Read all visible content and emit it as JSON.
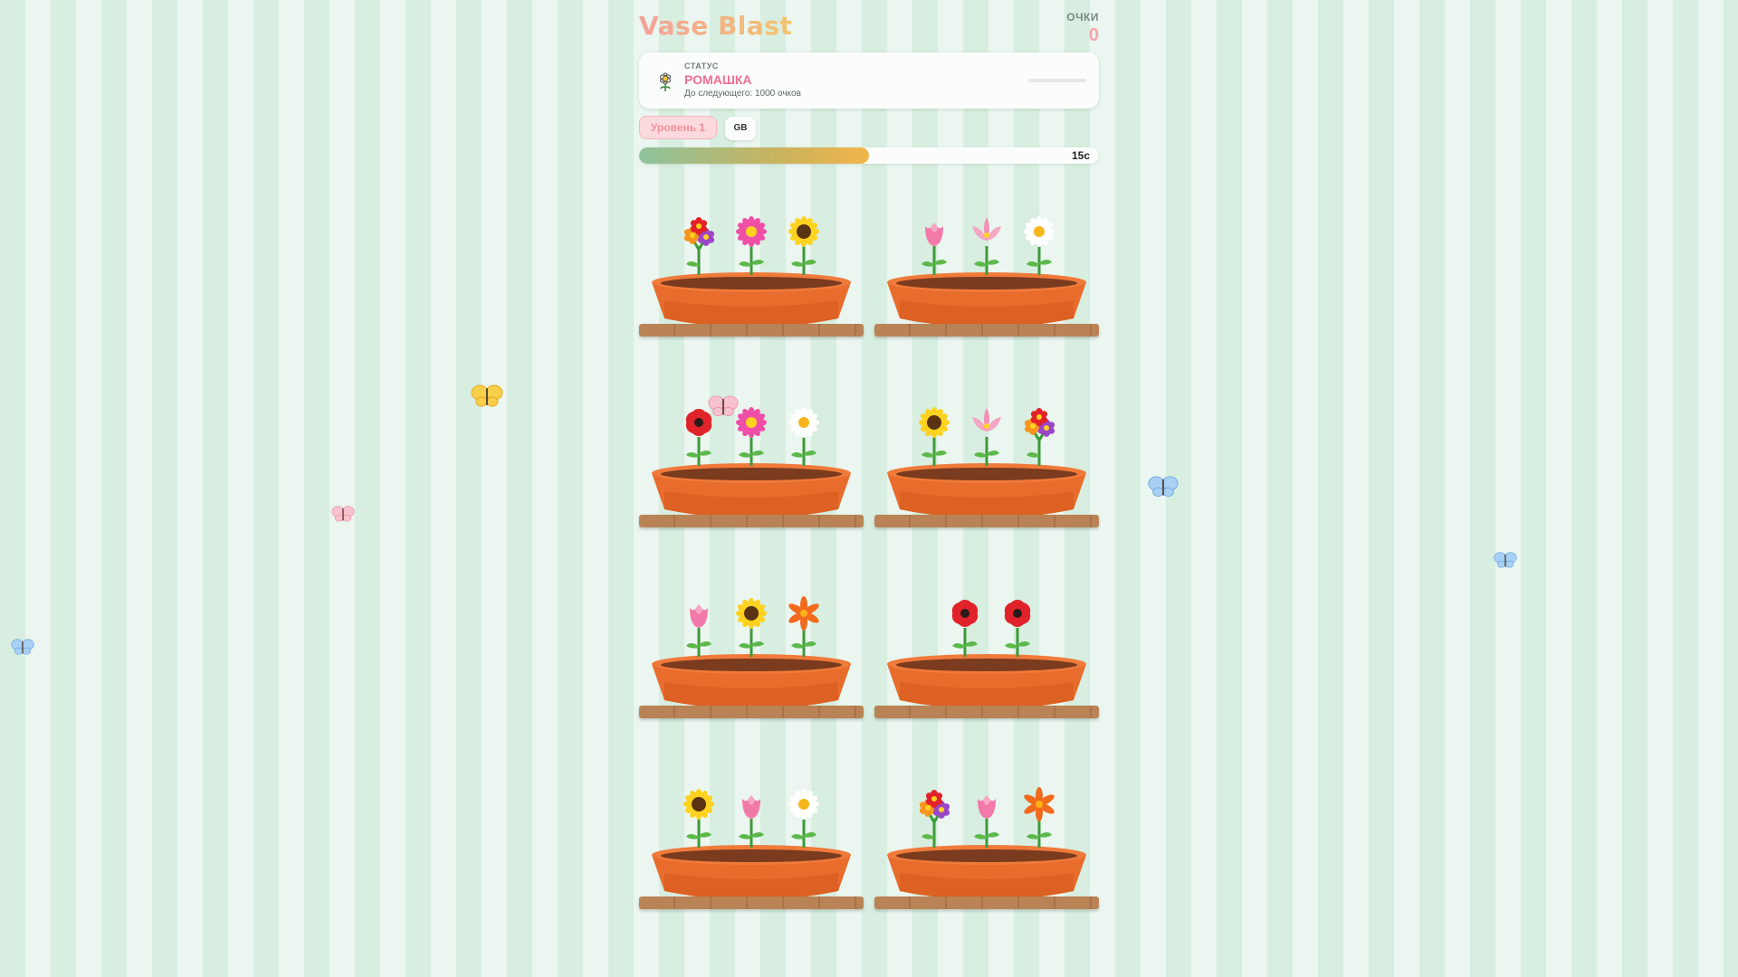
{
  "game": {
    "title": "Vase Blast"
  },
  "score": {
    "label": "ОЧКИ",
    "value": "0"
  },
  "status": {
    "label": "СТАТУС",
    "rank": "РОМАШКА",
    "next": "До следующего: 1000 очков",
    "progress": 0
  },
  "level": {
    "label": "Уровень 1"
  },
  "language": {
    "label": "GB"
  },
  "timer": {
    "text": "15с",
    "fraction": 0.5
  },
  "colors": {
    "accent_pink": "#f06d90",
    "pot": "#e86c2c",
    "shelf": "#b98356"
  },
  "vases": [
    {
      "flowers": [
        "bouquet",
        "pink-daisy",
        "sunflower"
      ]
    },
    {
      "flowers": [
        "pink-tulip",
        "lotus",
        "white-daisy"
      ]
    },
    {
      "flowers": [
        "red-poppy",
        "pink-daisy",
        "white-daisy"
      ]
    },
    {
      "flowers": [
        "sunflower",
        "lotus",
        "bouquet"
      ]
    },
    {
      "flowers": [
        "pink-tulip",
        "sunflower",
        "orange-lily"
      ]
    },
    {
      "flowers": [
        "red-poppy",
        "red-poppy"
      ]
    },
    {
      "flowers": [
        "sunflower",
        "pink-tulip",
        "white-daisy"
      ]
    },
    {
      "flowers": [
        "bouquet",
        "pink-tulip",
        "orange-lily"
      ]
    }
  ],
  "butterflies": [
    "yellow-butterfly",
    "pink-butterfly",
    "pink-butterfly",
    "blue-butterfly",
    "blue-butterfly",
    "blue-butterfly"
  ]
}
